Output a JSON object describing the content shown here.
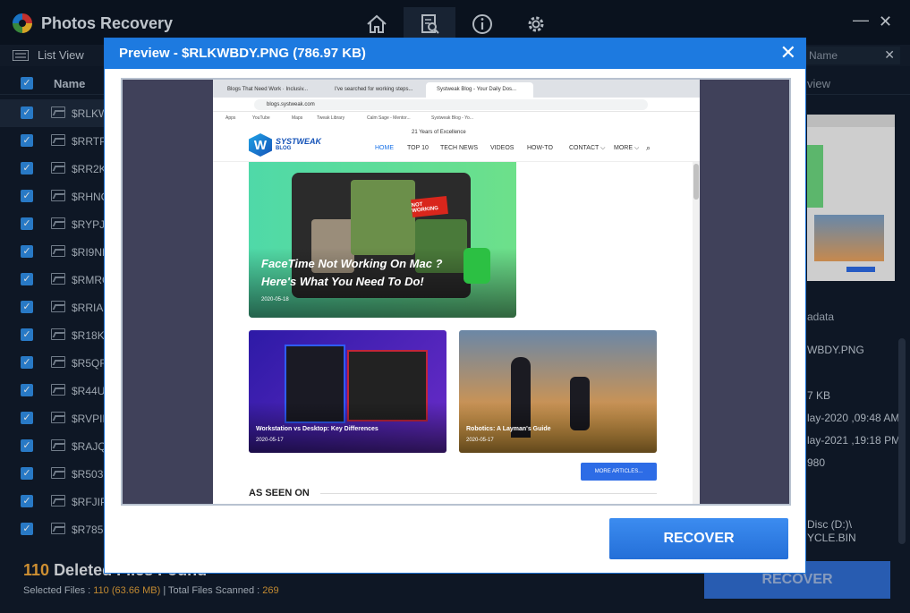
{
  "app": {
    "title": "Photos Recovery",
    "nav": [
      "home-icon",
      "scan-icon",
      "info-icon",
      "settings-icon"
    ],
    "window": {
      "minimize": "—",
      "close": "✕"
    }
  },
  "toolbar": {
    "list_view": "List View",
    "search_placeholder": "Name",
    "search_clear": "✕"
  },
  "columns": {
    "name": "Name",
    "preview": "view"
  },
  "files": [
    "$RLKW",
    "$RRTPJ",
    "$RR2K",
    "$RHNC",
    "$RYPJ",
    "$RI9NF",
    "$RMRC",
    "$RRIAF",
    "$R18KV",
    "$R5QF",
    "$R44UI",
    "$RVPID",
    "$RAJQ",
    "$R5037",
    "$RFJIPY",
    "$R785"
  ],
  "metadata": {
    "heading": "adata",
    "lines": [
      "WBDY.PNG",
      "7 KB",
      "lay-2020 ,09:48 AM",
      "lay-2021 ,19:18 PM",
      "980",
      "Disc (D:)\\",
      "YCLE.BIN"
    ]
  },
  "footer": {
    "count": "110",
    "label": "Deleted Files Found",
    "selected_label": "Selected Files :",
    "selected_value": "110 (63.66 MB)",
    "total_label": "| Total Files Scanned :",
    "total_value": "269",
    "recover": "RECOVER"
  },
  "modal": {
    "title": "Preview - $RLKWBDY.PNG  (786.97 KB)",
    "close": "✕",
    "recover": "RECOVER"
  },
  "preview_shot": {
    "tabs": [
      "Blogs That Need Work · Inclusiv...",
      "I've searched for working steps...",
      "Systweak Blog - Your Daily Dos..."
    ],
    "url": "blogs.systweak.com",
    "bookmarks": [
      "Apps",
      "YouTube",
      "Maps",
      "Tweak Library",
      "Calm Sage - Mentor...",
      "Systweak Blog - Yo..."
    ],
    "site": {
      "name": "SYSTWEAK",
      "sub": "BLOG",
      "years": "21 Years of Excellence"
    },
    "menu": [
      "HOME",
      "TOP 10",
      "TECH NEWS",
      "VIDEOS",
      "HOW-TO",
      "CONTACT ⌵",
      "MORE ⌵"
    ],
    "big_card": {
      "title_1": "FaceTime Not Working On Mac ?",
      "title_2": "Here's What You Need To Do!",
      "date": "2020-05-18",
      "badge": "NOT WORKING"
    },
    "card_left": {
      "title": "Workstation vs Desktop: Key Differences",
      "date": "2020-05-17"
    },
    "card_right": {
      "title": "Robotics: A Layman's Guide",
      "date": "2020-05-17"
    },
    "more": "MORE ARTICLES...",
    "seen": "AS SEEN ON"
  },
  "colors": {
    "accent": "#1d7ae0",
    "count": "#f2a93b",
    "background": "#111c2c"
  }
}
